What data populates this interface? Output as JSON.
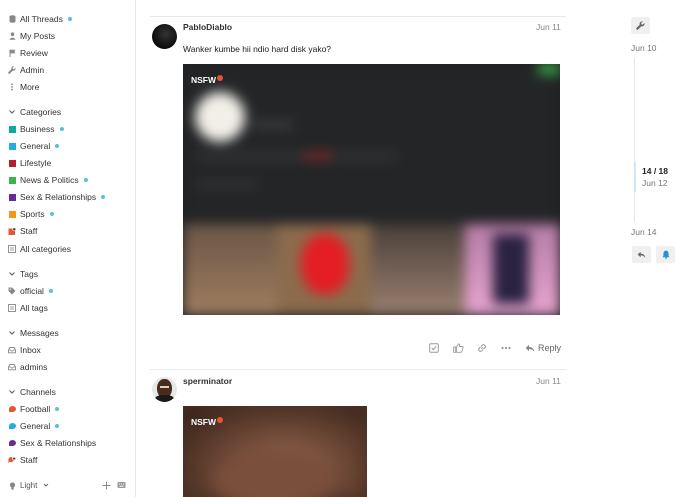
{
  "sidebar": {
    "top_items": [
      {
        "label": "All Threads",
        "icon": "stack-icon",
        "dot": true
      },
      {
        "label": "My Posts",
        "icon": "user-icon",
        "dot": false
      },
      {
        "label": "Review",
        "icon": "flag-icon",
        "dot": false
      },
      {
        "label": "Admin",
        "icon": "wrench-icon",
        "dot": false
      },
      {
        "label": "More",
        "icon": "ellipsis-icon",
        "dot": false
      }
    ],
    "categories": {
      "heading": "Categories",
      "items": [
        {
          "label": "Business",
          "color": "#12a89d",
          "dot": true
        },
        {
          "label": "General",
          "color": "#25aae1",
          "dot": true
        },
        {
          "label": "Lifestyle",
          "color": "#b3202a",
          "dot": false
        },
        {
          "label": "News & Politics",
          "color": "#3ab54a",
          "dot": true
        },
        {
          "label": "Sex & Relationships",
          "color": "#652d90",
          "dot": true
        },
        {
          "label": "Sports",
          "color": "#f7941d",
          "dot": true
        },
        {
          "label": "Staff",
          "color": "#e45735",
          "dot": false
        }
      ],
      "all_label": "All categories"
    },
    "tags": {
      "heading": "Tags",
      "items": [
        {
          "label": "official",
          "dot": true
        }
      ],
      "all_label": "All tags"
    },
    "messages": {
      "heading": "Messages",
      "items": [
        {
          "label": "Inbox"
        },
        {
          "label": "admins"
        }
      ]
    },
    "channels": {
      "heading": "Channels",
      "items": [
        {
          "label": "Football",
          "color": "#e45735",
          "dot": true
        },
        {
          "label": "General",
          "color": "#25aae1",
          "dot": true
        },
        {
          "label": "Sex & Relationships",
          "color": "#652d90",
          "dot": false
        },
        {
          "label": "Staff",
          "color": "#e45735",
          "dot": false
        }
      ]
    },
    "footer": {
      "theme_label": "Light"
    }
  },
  "posts": [
    {
      "username": "PabloDiablo",
      "date": "Jun 11",
      "text": "Wanker kumbe hii ndio hard disk yako?",
      "nsfw_label": "NSFW"
    },
    {
      "username": "sperminator",
      "date": "Jun 11",
      "text": "",
      "nsfw_label": "NSFW"
    }
  ],
  "post_actions": {
    "reply_label": "Reply"
  },
  "timeline": {
    "start_date": "Jun 10",
    "position": "14 / 18",
    "position_date": "Jun 12",
    "end_date": "Jun 14"
  }
}
